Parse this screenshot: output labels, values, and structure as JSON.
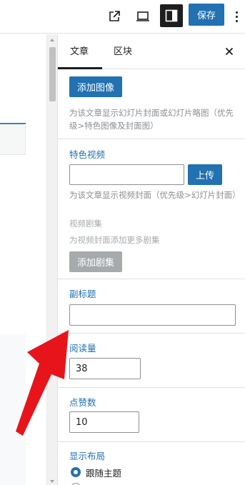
{
  "toolbar": {
    "save_label": "保存",
    "icons": [
      "external-link-icon",
      "preview-icon",
      "settings-sidebar-icon",
      "more-options-icon"
    ]
  },
  "sidebar": {
    "tabs": [
      {
        "label": "文章",
        "active": true
      },
      {
        "label": "区块",
        "active": false
      }
    ],
    "cover": {
      "add_image_label": "添加图像",
      "description": "为该文章显示幻灯片封面或幻灯片略图（优先级>特色图像及封面图）"
    },
    "featured_video": {
      "title": "特色视频",
      "input_value": "",
      "upload_label": "上传",
      "description": "为该文章显示视频封面（优先级>幻灯片封面）",
      "episodes_title": "视频剧集",
      "episodes_description": "为视频封面添加更多剧集",
      "add_episode_label": "添加剧集"
    },
    "subtitle": {
      "title": "副标题",
      "value": ""
    },
    "read_count": {
      "title": "阅读量",
      "value": "38"
    },
    "like_count": {
      "title": "点赞数",
      "value": "10"
    },
    "display_layout": {
      "title": "显示布局",
      "options": [
        {
          "label": "跟随主题",
          "selected": true
        }
      ]
    }
  },
  "colors": {
    "accent": "#2271b1",
    "annotation_arrow": "#e8141c"
  }
}
